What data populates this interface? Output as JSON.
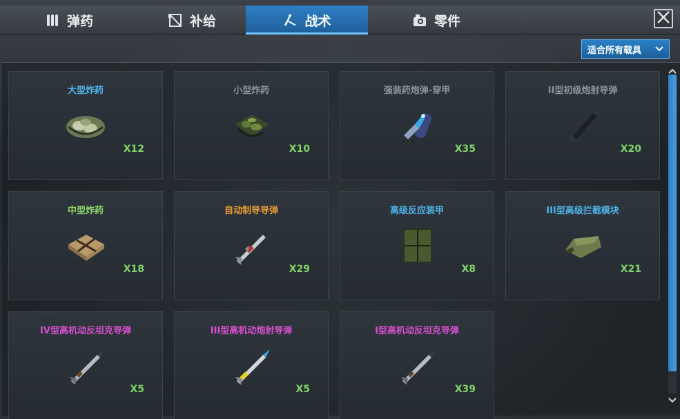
{
  "tabs": [
    {
      "label": "弹药",
      "icon": "bullets-icon",
      "active": false
    },
    {
      "label": "补给",
      "icon": "supply-crate-icon",
      "active": false
    },
    {
      "label": "战术",
      "icon": "tactics-icon",
      "active": true
    },
    {
      "label": "零件",
      "icon": "camera-part-icon",
      "active": false
    }
  ],
  "filter": {
    "label": "适合所有载具"
  },
  "items": [
    {
      "name": "大型炸药",
      "qty": "X12",
      "color": "#4fb3e8",
      "icon": "large-explosive-icon"
    },
    {
      "name": "小型炸药",
      "qty": "X10",
      "color": "#8a939b",
      "icon": "small-explosive-icon"
    },
    {
      "name": "强装药炮弹-穿甲",
      "qty": "X35",
      "color": "#8a939b",
      "icon": "ap-shell-icon"
    },
    {
      "name": "II型初级炮射导弹",
      "qty": "X20",
      "color": "#8a939b",
      "icon": "gun-missile-icon"
    },
    {
      "name": "中型炸药",
      "qty": "X18",
      "color": "#8fd46a",
      "icon": "medium-explosive-icon"
    },
    {
      "name": "自动制导导弹",
      "qty": "X29",
      "color": "#e79a34",
      "icon": "guided-missile-icon"
    },
    {
      "name": "高级反应装甲",
      "qty": "X8",
      "color": "#4fb3e8",
      "icon": "reactive-armor-icon"
    },
    {
      "name": "III型高级拦截模块",
      "qty": "X21",
      "color": "#4fb3e8",
      "icon": "interceptor-module-icon"
    },
    {
      "name": "IV型高机动反坦克导弹",
      "qty": "X5",
      "color": "#d94fd0",
      "icon": "atgm-icon"
    },
    {
      "name": "III型高机动炮射导弹",
      "qty": "X5",
      "color": "#d94fd0",
      "icon": "yellow-missile-icon"
    },
    {
      "name": "I型高机动反坦克导弹",
      "qty": "X39",
      "color": "#d94fd0",
      "icon": "atgm-icon"
    }
  ]
}
